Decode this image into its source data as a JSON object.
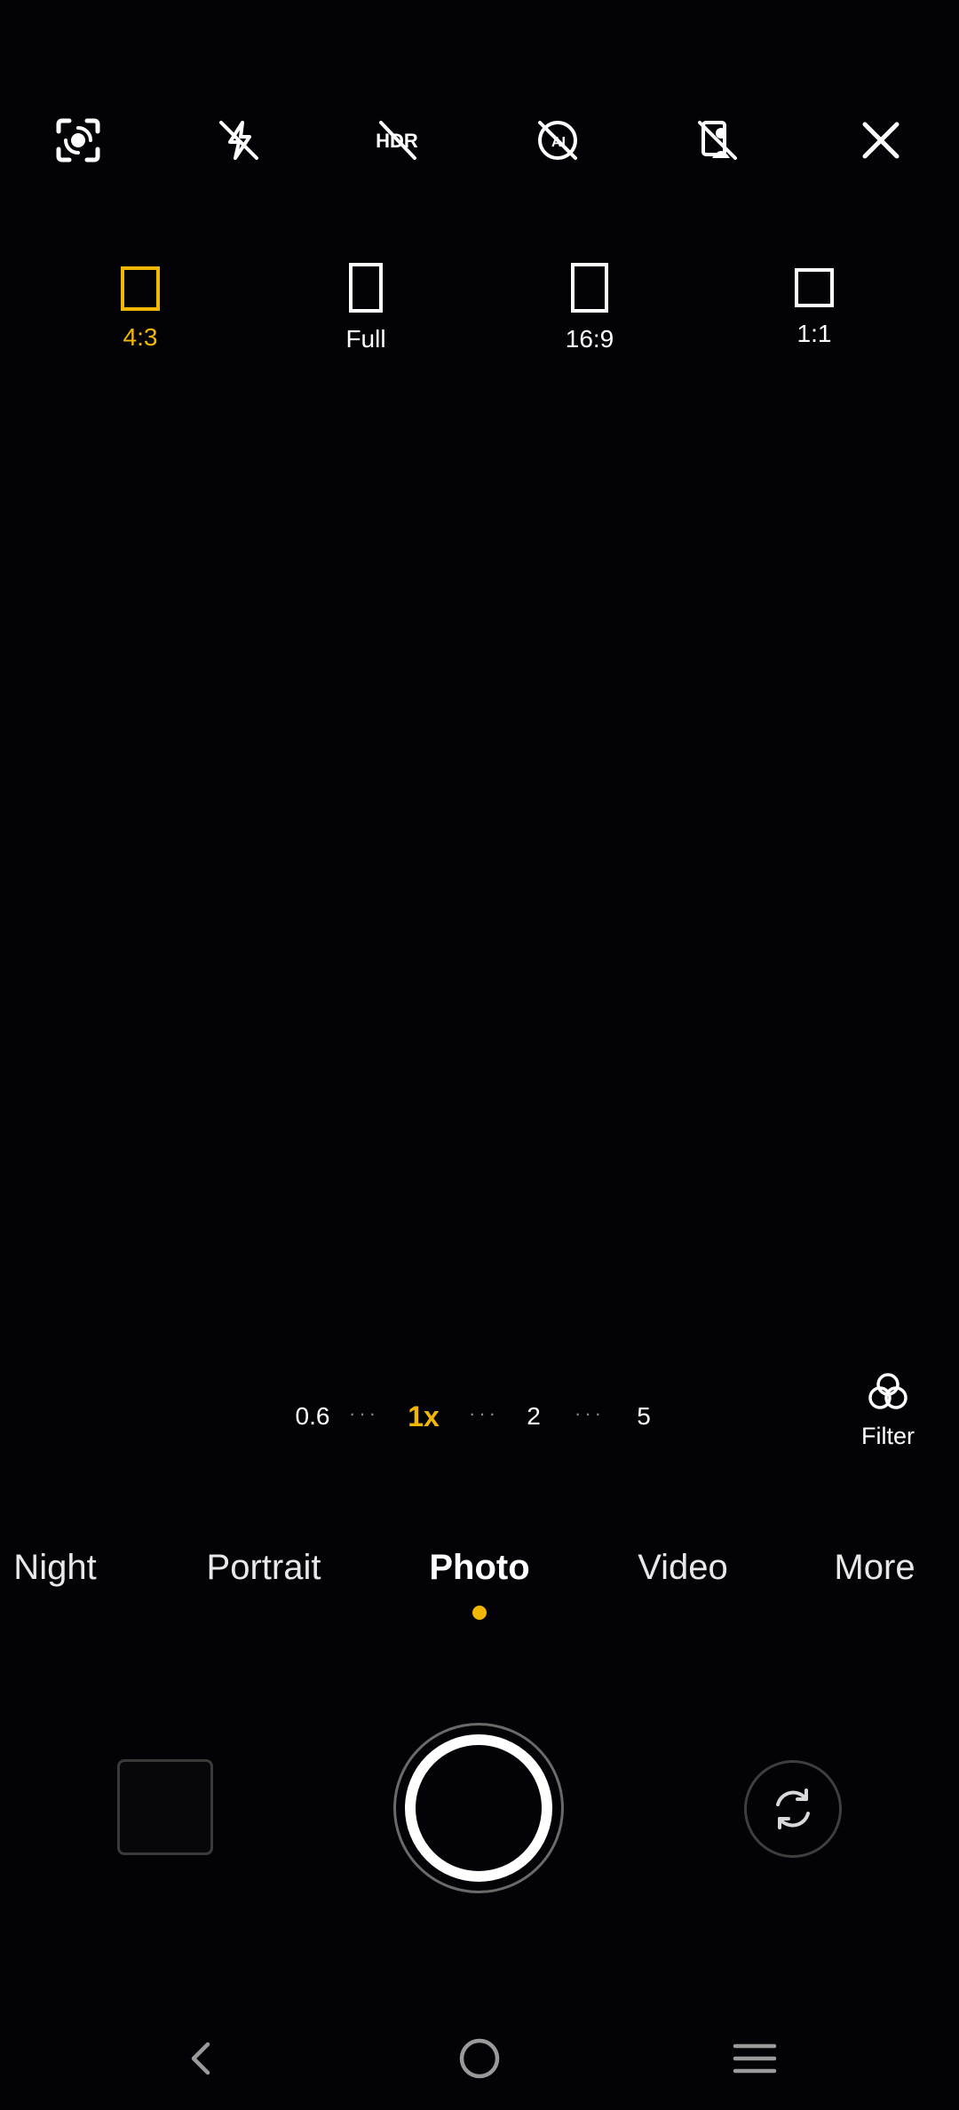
{
  "colors": {
    "accent": "#f2b705",
    "background": "#030206",
    "text": "#ffffff"
  },
  "top_bar": {
    "icons": [
      "scan-icon",
      "flash-off-icon",
      "hdr-off-icon",
      "ai-off-icon",
      "portrait-off-icon",
      "close-icon"
    ]
  },
  "ratios": [
    {
      "label": "4:3",
      "selected": true
    },
    {
      "label": "Full",
      "selected": false
    },
    {
      "label": "16:9",
      "selected": false
    },
    {
      "label": "1:1",
      "selected": false
    }
  ],
  "zoom": {
    "levels": [
      "0.6",
      "1x",
      "2",
      "5"
    ],
    "active": "1x"
  },
  "filter": {
    "label": "Filter"
  },
  "modes": {
    "items": [
      "Night",
      "Portrait",
      "Photo",
      "Video",
      "More"
    ],
    "active": "Photo"
  }
}
